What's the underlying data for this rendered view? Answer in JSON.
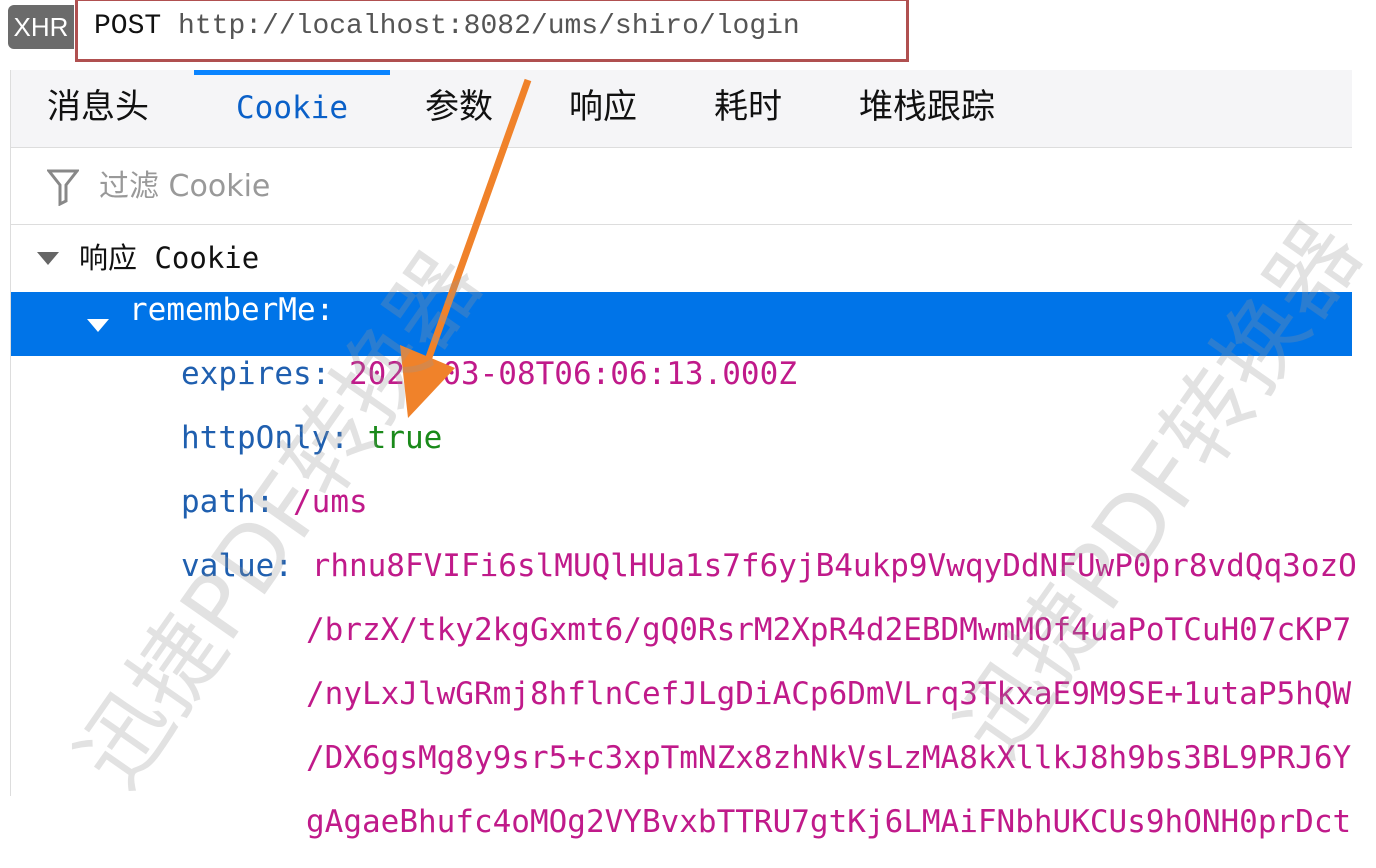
{
  "request": {
    "type_badge": "XHR",
    "method": "POST",
    "url": "http://localhost:8082/ums/shiro/login"
  },
  "tabs": [
    {
      "label": "消息头"
    },
    {
      "label": "Cookie",
      "active": true
    },
    {
      "label": "参数"
    },
    {
      "label": "响应"
    },
    {
      "label": "耗时"
    },
    {
      "label": "堆栈跟踪"
    }
  ],
  "filter": {
    "icon": "filter-icon",
    "placeholder": "过滤 Cookie"
  },
  "section": {
    "label": "响应 Cookie"
  },
  "cookie": {
    "name": "rememberMe:",
    "fields": [
      {
        "key": "expires:",
        "value": "2020-03-08T06:06:13.000Z"
      },
      {
        "key": "httpOnly:",
        "value": "true"
      },
      {
        "key": "path:",
        "value": "/ums"
      },
      {
        "key": "value:",
        "value": "rhnu8FVIFi6slMUQlHUa1s7f6yjB4ukp9VwqyDdNFUwP0pr8vdQq3ozO"
      }
    ],
    "value_continuation": [
      "/brzX/tky2kgGxmt6/gQ0RsrM2XpR4d2EBDMwmMOf4uaPoTCuH07cKP7",
      "/nyLxJlwGRmj8hflnCefJLgDiACp6DmVLrq3TkxaE9M9SE+1utaP5hQW",
      "/DX6gsMg8y9sr5+c3xpTmNZx8zhNkVsLzMA8kXllkJ8h9bs3BL9PRJ6Y",
      "gAgaeBhufc4oMOg2VYBvxbTTRU7gtKj6LMAiFNbhUKCUs9hONH0prDct"
    ]
  },
  "watermark": "迅捷PDF转换器",
  "colors": {
    "selected": "#0074e8",
    "key": "#1f5faf",
    "value": "#c01a8a",
    "boolean": "#1a8a1a",
    "arrow": "#f0822a",
    "tab_active": "#0a84ff"
  }
}
